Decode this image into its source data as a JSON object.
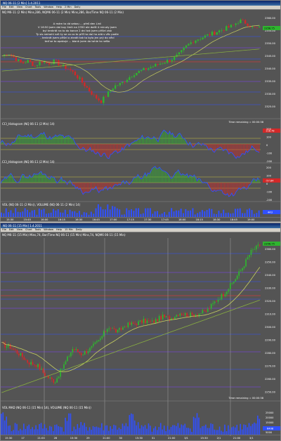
{
  "window1": {
    "title": "NQ 06-11 [2 Min] 1.4.2011",
    "toolbar": [
      "File",
      "Edit",
      "View",
      "Chart",
      "Tools",
      "Window",
      "Help",
      "2 Min",
      "Daily"
    ],
    "price_label": "NQ M6-11 (2 Min) Mins,286, NQM6 06-11 (2 Min) Mins,286, Bar/Time NQ 06-11 (2 Min)",
    "annotation": [
      "A mám to dá sebou ... přeš den Linii",
      "V 16:50 jsem dal buy limit na 2350 ale další 4 minuty jsem",
      "byl tenkrát na to do konce 2 dní tak jsem přišel zisk",
      "Ty sis nemohl vzít ty se co co to přiť ho dal ho zdá s věc podle",
      "- tenkrát jsem přišel o ztratit tak to bylo jen prý do věcí",
      "teď se to opakuje ... blank jsem do tohle to nešlo"
    ],
    "price_tag": "2356.75",
    "price_axis": [
      "2360.00",
      "2355.00",
      "2350.00",
      "2345.00",
      "2340.00",
      "2335.00",
      "2330.00",
      "2325.00"
    ],
    "osc1_label": "CCI_Histogram (NQ 06-11 (2 Min) 14)",
    "osc1_tag": "118.78",
    "osc1_axis": [
      "200",
      "100",
      "0",
      "-100",
      "-200"
    ],
    "osc2_label": "CCI_Histogram (NQ 06-11 (2 Min) 14)",
    "osc2_tag": "-57.84",
    "osc2_axis": [
      "200",
      "100",
      "0",
      "-100",
      "-200"
    ],
    "vol_label": "VOL (NQ 06-11 (2 Min)), VOLUME (NQ 06-11 (2 Min) 14)",
    "vol_tag": "443",
    "time_remaining": "Time remaining = 00:00:38",
    "time_axis": [
      "15:30",
      "15:45",
      "16:00",
      "16:15",
      "16:30",
      "16:45",
      "17:00",
      "17:15",
      "17:30",
      "17:45",
      "18:00",
      "18:15",
      "18:30",
      "18:45",
      "19:00"
    ],
    "colors": {
      "bg": "#545454",
      "up": "#2fb52f",
      "down": "#d22828",
      "ma1": "#8ab040",
      "ma2": "#c8d060",
      "line_blue": "#3050ff",
      "line_purple": "#8040ff",
      "line_red": "#ff3030"
    }
  },
  "window2": {
    "title": "NQ 06-11 [15 Min] 1.4.2011",
    "toolbar": [
      "File",
      "Edit",
      "View",
      "Chart",
      "Tools",
      "Window",
      "Help",
      "15 Min",
      "Daily"
    ],
    "price_label": "NQ M6-11 (15 Min) Mins,74, Bar/Time NQ 06-11 (15 Min) Mins,74, NQM6 06-11 (15 Min)",
    "price_tag": "2356.75",
    "price_axis": [
      "2360.00",
      "2350.00",
      "2340.00",
      "2330.00",
      "2320.00",
      "2310.00",
      "2300.00",
      "2290.00",
      "2280.00",
      "2270.00",
      "2260.00",
      "2250.00"
    ],
    "vol_label": "VOL MAD (NQ 06-11 (15 Min) 14), VOLUME (NQ 06-11 (15 Min))",
    "vol_tag": "6408",
    "vol_axis": [
      "25000",
      "20000",
      "15000",
      "10000",
      "5000"
    ],
    "time_remaining": "Time remaining = 00:00:38",
    "time_axis": [
      "15:30",
      "17",
      "21:00",
      "28",
      "15:30",
      "29",
      "21:00",
      "30",
      "15:30",
      "31",
      "21:00",
      "3/1",
      "15:30",
      "2/1",
      "21:00",
      "3/1"
    ]
  },
  "chart_data": [
    {
      "type": "line",
      "name": "NQ 06-11 2 Min",
      "series": [
        {
          "name": "price",
          "values": [
            2346,
            2347,
            2345,
            2343,
            2344,
            2342,
            2344,
            2343,
            2344,
            2342,
            2341,
            2339,
            2336,
            2333,
            2330,
            2328,
            2331,
            2334,
            2335,
            2337,
            2339,
            2340,
            2341,
            2342,
            2343,
            2344,
            2345,
            2347,
            2350,
            2352,
            2353,
            2354,
            2355,
            2356,
            2357,
            2358,
            2360,
            2359,
            2357,
            2357
          ]
        }
      ],
      "ylim": [
        2322,
        2362
      ]
    },
    {
      "type": "line",
      "name": "NQ 06-11 15 Min",
      "series": [
        {
          "name": "price",
          "values": [
            2285,
            2283,
            2278,
            2272,
            2270,
            2262,
            2258,
            2270,
            2282,
            2278,
            2282,
            2288,
            2298,
            2294,
            2299,
            2300,
            2302,
            2301,
            2305,
            2304,
            2308,
            2306,
            2307,
            2309,
            2316,
            2322,
            2330,
            2340,
            2352,
            2357
          ]
        }
      ],
      "ylim": [
        2248,
        2362
      ]
    }
  ]
}
